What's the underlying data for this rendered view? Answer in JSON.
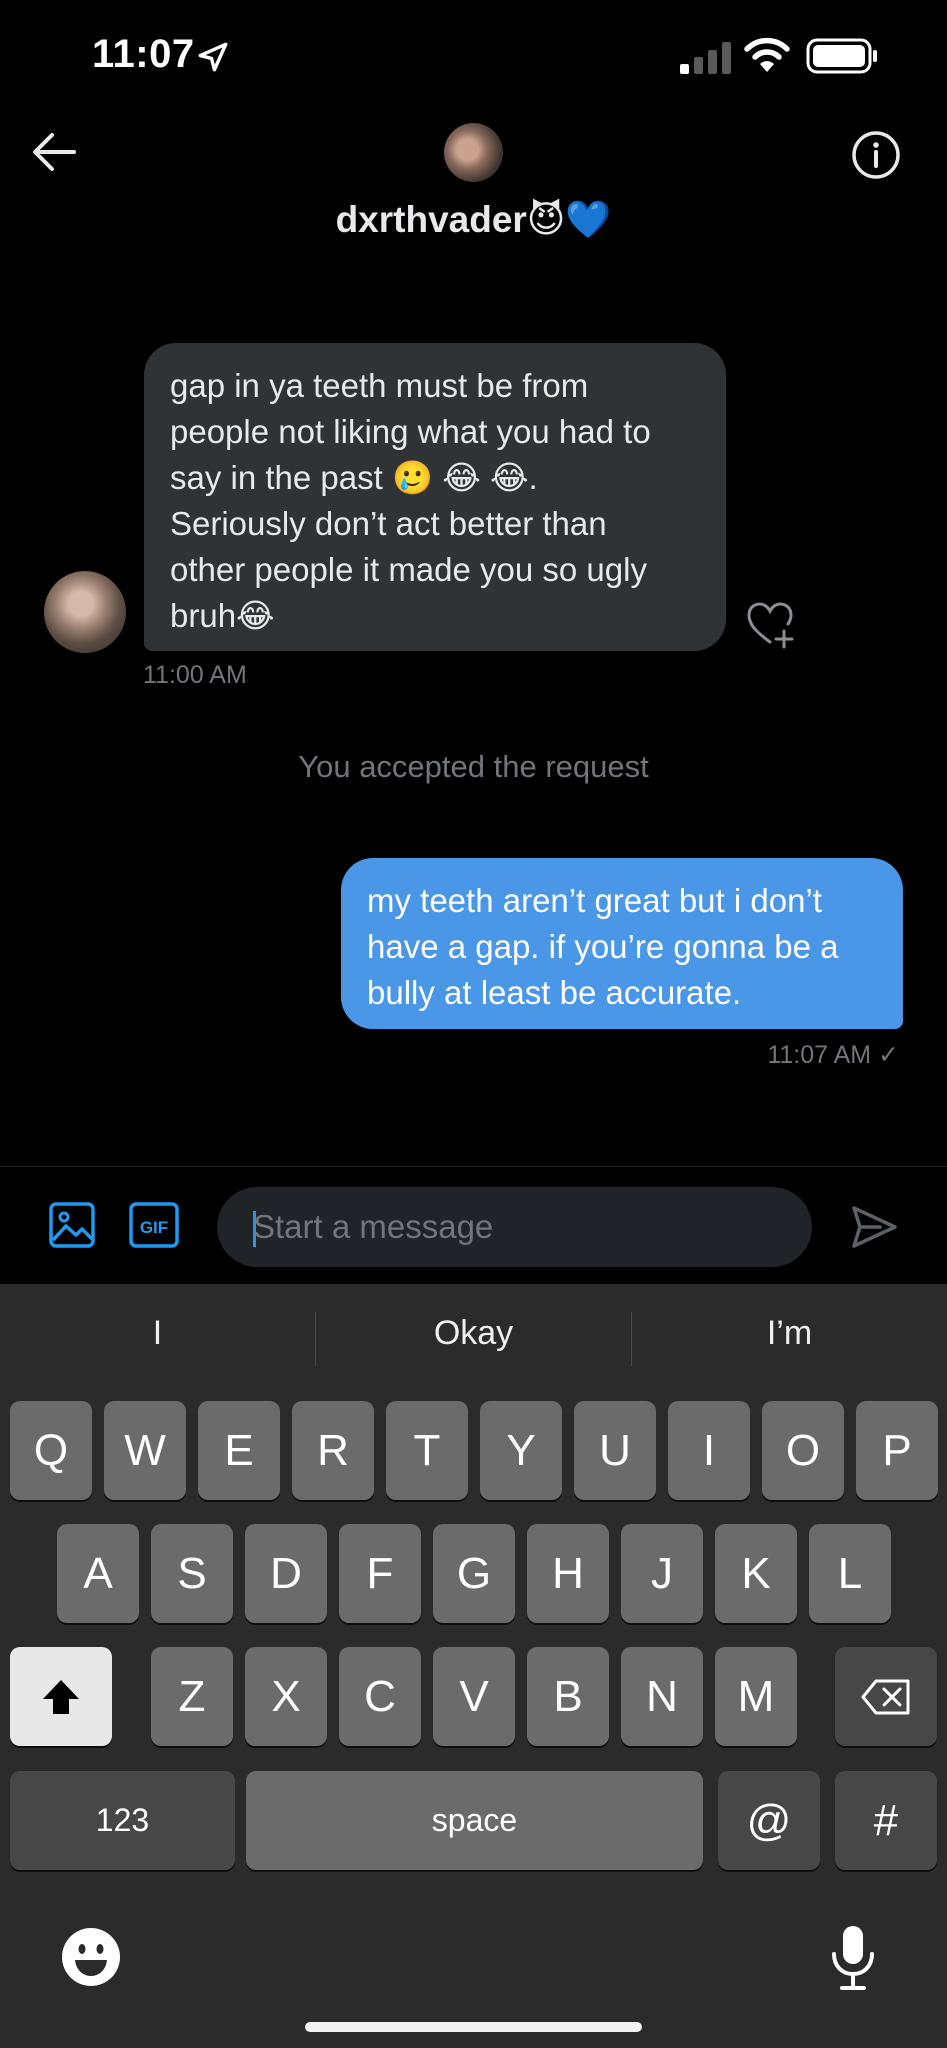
{
  "status_bar": {
    "time": "11:07"
  },
  "header": {
    "username": "dxrthvader😈💙"
  },
  "messages": {
    "incoming": {
      "text": "gap in ya teeth must be from\npeople not liking what you had to\nsay in the past 🥲 😂 😂.\nSeriously don’t act better than\nother people it made you so ugly\nbruh😂",
      "time": "11:00 AM"
    },
    "system": "You accepted the request",
    "outgoing": {
      "text": "my teeth aren’t great but i don’t\nhave a gap. if you’re gonna be a\nbully at least be accurate.",
      "time": "11:07 AM ✓"
    }
  },
  "composer": {
    "placeholder": "Start a message"
  },
  "keyboard": {
    "suggestions": [
      "I",
      "Okay",
      "I’m"
    ],
    "row1": [
      "Q",
      "W",
      "E",
      "R",
      "T",
      "Y",
      "U",
      "I",
      "O",
      "P"
    ],
    "row2": [
      "A",
      "S",
      "D",
      "F",
      "G",
      "H",
      "J",
      "K",
      "L"
    ],
    "row3": [
      "Z",
      "X",
      "C",
      "V",
      "B",
      "N",
      "M"
    ],
    "numbers_label": "123",
    "space_label": "space",
    "at_label": "@",
    "hash_label": "#"
  },
  "colors": {
    "accent": "#4a97e8",
    "incoming_bubble": "#2f3336",
    "muted_text": "#71767b"
  }
}
